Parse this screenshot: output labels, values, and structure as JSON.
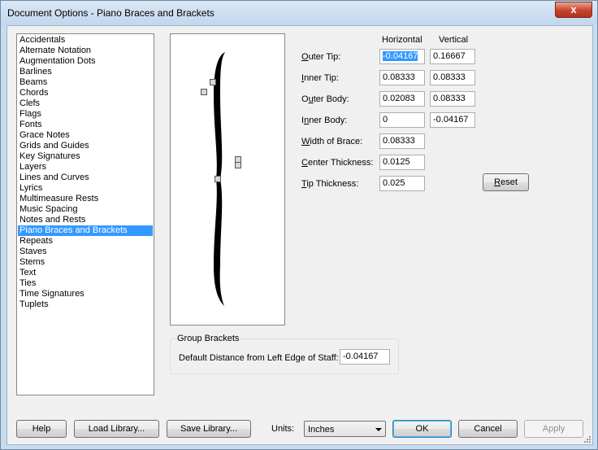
{
  "window": {
    "title": "Document Options - Piano Braces and Brackets",
    "close_glyph": "x"
  },
  "categories": [
    "Accidentals",
    "Alternate Notation",
    "Augmentation Dots",
    "Barlines",
    "Beams",
    "Chords",
    "Clefs",
    "Flags",
    "Fonts",
    "Grace Notes",
    "Grids and Guides",
    "Key Signatures",
    "Layers",
    "Lines and Curves",
    "Lyrics",
    "Multimeasure Rests",
    "Music Spacing",
    "Notes and Rests",
    "Piano Braces and Brackets",
    "Repeats",
    "Staves",
    "Stems",
    "Text",
    "Ties",
    "Time Signatures",
    "Tuplets"
  ],
  "selected_category": "Piano Braces and Brackets",
  "columns": {
    "horizontal": "Horizontal",
    "vertical": "Vertical"
  },
  "fields": {
    "outer_tip": {
      "label_u": "O",
      "label_rest": "uter Tip:",
      "h": "-0.04167",
      "v": "0.16667"
    },
    "inner_tip": {
      "label_u": "I",
      "label_rest": "nner Tip:",
      "h": "0.08333",
      "v": "0.08333"
    },
    "outer_body": {
      "label_pre": "O",
      "label_u": "u",
      "label_rest": "ter Body:",
      "h": "0.02083",
      "v": "0.08333"
    },
    "inner_body": {
      "label_pre": "I",
      "label_u": "n",
      "label_rest": "ner Body:",
      "h": "0",
      "v": "-0.04167"
    },
    "width_of_brace": {
      "label_u": "W",
      "label_rest": "idth of Brace:",
      "value": "0.08333"
    },
    "center_thickness": {
      "label_u": "C",
      "label_rest": "enter Thickness:",
      "value": "0.0125"
    },
    "tip_thickness": {
      "label_u": "T",
      "label_rest": "ip Thickness:",
      "value": "0.025"
    }
  },
  "reset_u": "R",
  "reset_rest": "eset",
  "group_brackets": {
    "title": "Group Brackets",
    "label": "Default Distance from Left Edge of Staff:",
    "value": "-0.04167"
  },
  "footer": {
    "help": "Help",
    "load": "Load Library...",
    "save": "Save Library...",
    "units_label": "Units:",
    "units_value": "Inches",
    "ok": "OK",
    "cancel": "Cancel",
    "apply": "Apply"
  }
}
